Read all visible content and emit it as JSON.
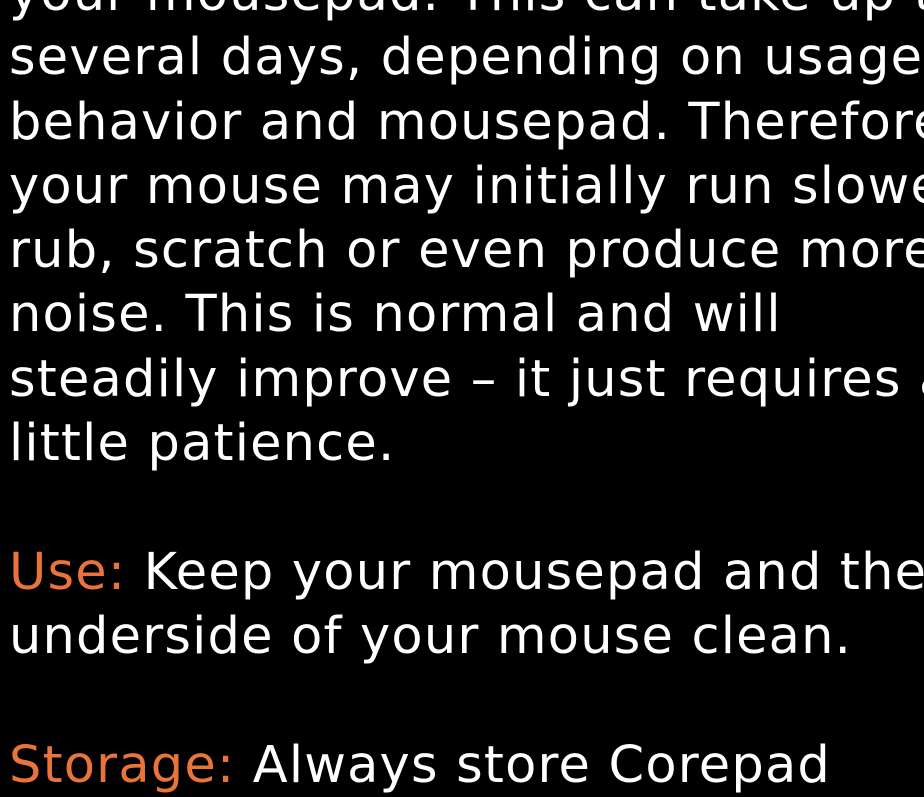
{
  "colors": {
    "background": "#000000",
    "text": "#ffffff",
    "label_accent": "#e8743a"
  },
  "intro_lines": [
    "your mousepad. This can take up to",
    "several days, depending on usage",
    "behavior and mousepad. Therefore,",
    "your mouse may initially run slower,",
    "rub, scratch or even produce more",
    "noise. This is normal and will",
    "steadily improve – it just requires a",
    "little patience."
  ],
  "use": {
    "label": "Use:",
    "line1": " Keep your mousepad and the",
    "line2": "underside of your mouse clean."
  },
  "storage": {
    "label": "Storage:",
    "line1": " Always store Corepad"
  }
}
